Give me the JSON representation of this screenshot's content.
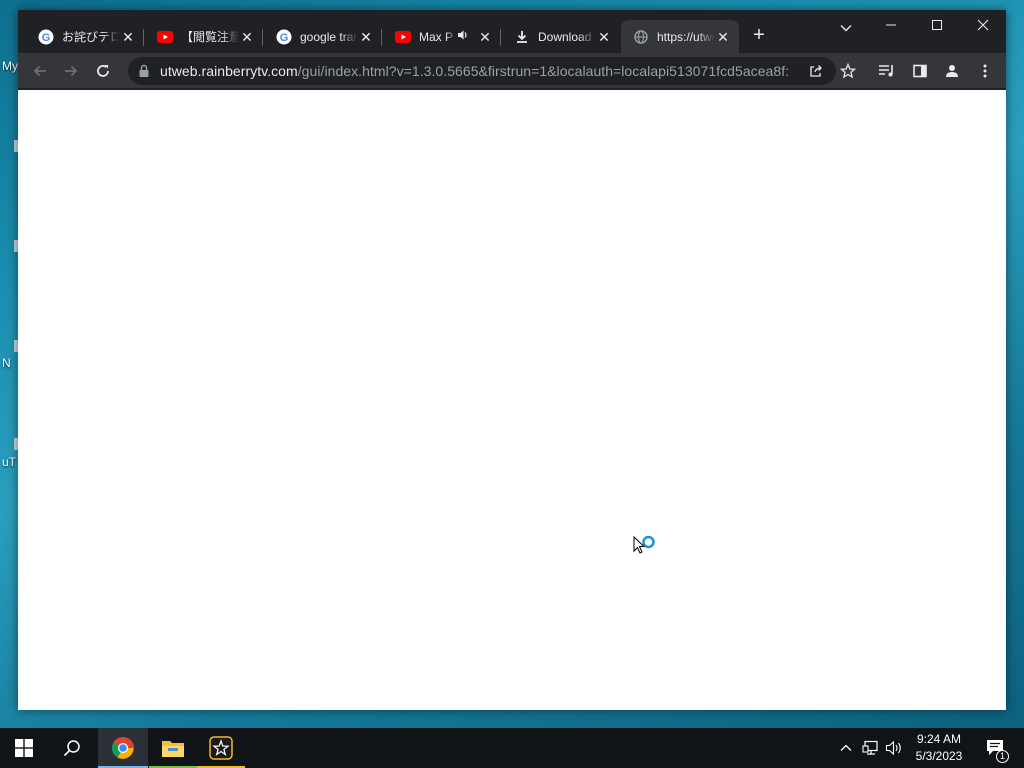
{
  "desktop": {
    "labels": [
      "My",
      "N",
      "uT"
    ]
  },
  "browser": {
    "tabs": [
      {
        "title": "お詫びテロップ",
        "favicon": "google-icon"
      },
      {
        "title": "【閲覧注意】",
        "favicon": "youtube-icon"
      },
      {
        "title": "google translate",
        "favicon": "google-icon"
      },
      {
        "title": "Max P",
        "favicon": "youtube-icon",
        "audio": "speaker-icon"
      },
      {
        "title": "Download",
        "favicon": "download-icon"
      },
      {
        "title": "https://utweb",
        "favicon": "globe-icon",
        "active": true
      }
    ],
    "address": {
      "host": "utweb.rainberrytv.com",
      "path": "/gui/index.html?v=1.3.0.5665&firstrun=1&localauth=localapi513071fcd5acea8f:"
    }
  },
  "taskbar": {
    "time": "9:24 AM",
    "date": "5/3/2023",
    "notification_count": "1"
  },
  "colors": {
    "tab_strip": "#202124",
    "toolbar": "#35363a",
    "accent": "#76b9ed",
    "youtube_red": "#ff0000"
  }
}
